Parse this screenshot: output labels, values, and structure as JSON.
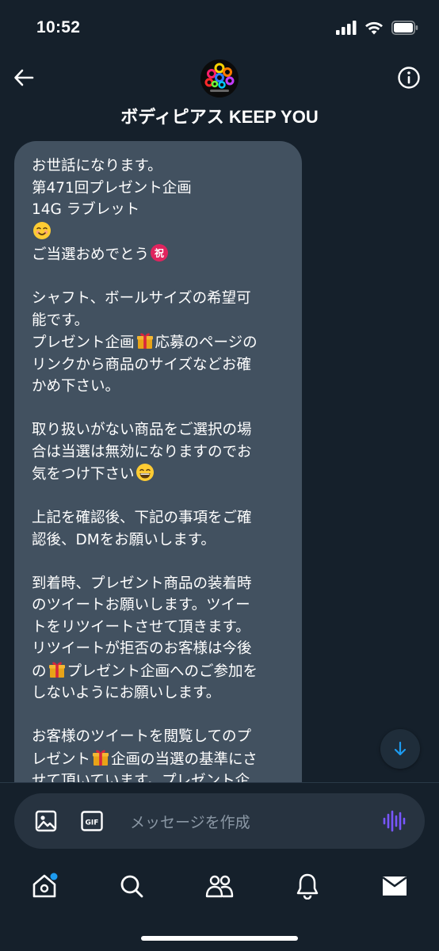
{
  "status_bar": {
    "time": "10:52"
  },
  "header": {
    "title": "ボディピアス KEEP YOU"
  },
  "message": {
    "lines": [
      {
        "text": "お世話になります。"
      },
      {
        "text": "第471回プレゼント企画"
      },
      {
        "text": "14G ラブレット"
      },
      {
        "text": "",
        "emoji_after": "smiling-face"
      },
      {
        "text": "ご当選おめでとう",
        "emoji_after": "congratulations-ideograph"
      },
      {
        "text": ""
      },
      {
        "text": "シャフト、ボールサイズの希望可"
      },
      {
        "text": "能です。"
      },
      {
        "text": "プレゼント企画",
        "emoji_after": "gift",
        "text_after": "応募のページの"
      },
      {
        "text": "リンクから商品のサイズなどお確"
      },
      {
        "text": "かめ下さい。"
      },
      {
        "text": ""
      },
      {
        "text": "取り扱いがない商品をご選択の場"
      },
      {
        "text": "合は当選は無効になりますのでお"
      },
      {
        "text": "気をつけ下さい",
        "emoji_after": "grinning-face"
      },
      {
        "text": ""
      },
      {
        "text": "上記を確認後、下記の事項をご確"
      },
      {
        "text": "認後、DMをお願いします。"
      },
      {
        "text": ""
      },
      {
        "text": "到着時、プレゼント商品の装着時"
      },
      {
        "text": "のツイートお願いします。ツイー"
      },
      {
        "text": "トをリツイートさせて頂きます。"
      },
      {
        "text": "リツイートが拒否のお客様は今後"
      },
      {
        "text": "の",
        "emoji_after": "gift",
        "text_after": "プレゼント企画へのご参加を"
      },
      {
        "text": "しないようにお願いします。"
      },
      {
        "text": ""
      },
      {
        "text": "お客様のツイートを閲覧してのプ"
      },
      {
        "text": "レゼント",
        "emoji_after": "gift",
        "text_after": "企画の当選の基準にさ"
      },
      {
        "text": "せて頂いています。プレゼント企"
      }
    ]
  },
  "composer": {
    "placeholder": "メッセージを作成",
    "gif_label": "GIF"
  },
  "colors": {
    "background": "#15202b",
    "bubble": "#425160",
    "composer": "#273340",
    "accent": "#1d9bf0",
    "voice": "#7856ff",
    "placeholder": "#8b98a5"
  },
  "icons": {
    "back": "back-arrow-icon",
    "info": "info-icon",
    "scroll_down": "arrow-down-icon",
    "image": "image-icon",
    "gif": "gif-icon",
    "voice": "voice-wave-icon",
    "nav": [
      "home-icon",
      "search-icon",
      "communities-icon",
      "notifications-icon",
      "messages-icon"
    ]
  }
}
